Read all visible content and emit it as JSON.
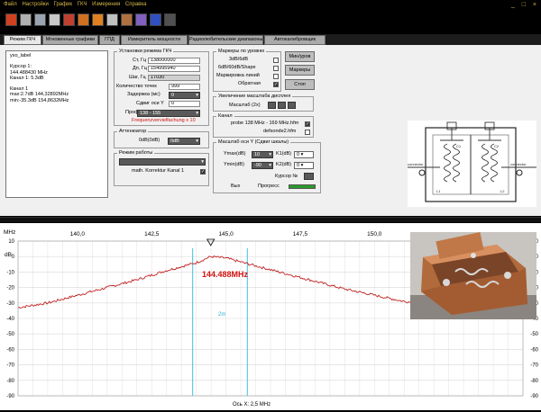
{
  "menu": {
    "items": [
      "Файл",
      "Настройки",
      "График",
      "ГКЧ",
      "Измерения",
      "Справка"
    ],
    "window_controls": "_ □ ×"
  },
  "toolbar": {
    "buttons": [
      {
        "name": "power-icon",
        "color": "#d14020"
      },
      {
        "name": "save-icon",
        "color": "#b0b0b0"
      },
      {
        "name": "print-icon",
        "color": "#9aa4b0"
      },
      {
        "name": "open-icon",
        "color": "#c8c8c8"
      },
      {
        "name": "measure-icon",
        "color": "#c04030"
      },
      {
        "name": "grid-icon",
        "color": "#d07020"
      },
      {
        "name": "chart-icon",
        "color": "#e08020"
      },
      {
        "name": "tool-icon",
        "color": "#c0c0c0"
      },
      {
        "name": "settings-icon",
        "color": "#b07040"
      },
      {
        "name": "calc-icon",
        "color": "#8060c0"
      },
      {
        "name": "window-icon",
        "color": "#3050c0"
      },
      {
        "name": "stop-icon",
        "color": "#505050"
      }
    ]
  },
  "tabs": [
    "Режим ГКЧ",
    "Мгновенные графики",
    "ГПД",
    "Измеритель мощности",
    "Радиолюбительские диапазоны",
    "Автокалибровщик"
  ],
  "info": {
    "title": "yxo_label",
    "cursor_label": "Курсор 1:",
    "cursor_freq": "144.488430 MHz",
    "cursor_level": "Канал 1:  5.3dB",
    "chan_label": "Канал 1",
    "max": "max:2.7dB 144,32892MHz",
    "min": "min:-35.3dB 154,8632MHz"
  },
  "gkch": {
    "legend": "Установки режима ГКЧ",
    "start_label": "Ст, Гц",
    "start_value": "138000000",
    "stop_label": "Дп, Гц",
    "stop_value": "154995940",
    "step_label": "Шаг, Гц",
    "step_value": "17030",
    "points_label": "Количество точек",
    "points_value": "999",
    "delay_label": "Задержка (мс)",
    "delay_value": "0",
    "yshift_label": "Сдвиг оси Y",
    "yshift_value": "0",
    "profile_label": "Проф",
    "profile_value": "138 - 155",
    "warning": "Frequenzvervielfachung x 10"
  },
  "attenuator": {
    "legend": "Аттенюатор",
    "db_label": "0dB(0dB)",
    "db_value": "0dB"
  },
  "mode": {
    "legend": "Режим работы",
    "select_value": "",
    "correction_label": "math. Korrektur Kanal 1"
  },
  "markers": {
    "legend": "Маркеры по уровню",
    "items": [
      "3dB/6dB",
      "6dB/60dB/Shape",
      "Маркировка линий",
      "Обратная"
    ],
    "checked": [
      false,
      false,
      false,
      true
    ],
    "btn_levels": "Мин/уров",
    "btn_markers": "Маркеры",
    "btn_stop": "Стоп"
  },
  "zoom": {
    "legend": "Увеличение масштаба дисплея",
    "label": "Масштаб (2x)"
  },
  "channel": {
    "legend": "Канал",
    "probe1": "probe 138 MHz - 169 MHz.hfm",
    "probe2": "defsonde2.hfm",
    "checked": [
      true,
      false
    ]
  },
  "scale": {
    "legend": "Масштаб оси Y (Сдвиг шкалы)",
    "ymax_label": "Ymax(dB)",
    "ymax_value": "10",
    "ymin_label": "Ymin(dB)",
    "ymin_value": "-90",
    "k1_label": "K1(dB)",
    "k1_value": "0",
    "k2_label": "K2(dB)",
    "k2_value": "0",
    "cursor_label": "Курсор №",
    "vbx_label": "Вых",
    "progress_label": "Прогресс",
    "progress": 1.0
  },
  "plot": {
    "unit_top": "MHz",
    "x_ticks": [
      "140,0",
      "142,5",
      "145,0",
      "147,5",
      "150,0"
    ],
    "y_unit": "dB",
    "y_ticks_left": [
      "10",
      "0",
      "-10",
      "-20",
      "-30",
      "-40",
      "-50",
      "-60",
      "-70",
      "-80",
      "-90"
    ],
    "y_ticks_right": [
      "10",
      "0",
      "-10",
      "-20",
      "-30",
      "-40",
      "-50",
      "-60",
      "-70",
      "-80",
      "-90"
    ],
    "peak_label": "144.488MHz",
    "bw_label": "2m",
    "x_axis_label": "Ось X: 2,5 MHz",
    "trace_color": "#c02020",
    "grid_color": "#d8d8d8",
    "marker_color": "#40c0e0"
  },
  "chart_data": {
    "type": "line",
    "title": "",
    "xlabel": "Ось X: 2,5 MHz",
    "ylabel": "dB",
    "xlim": [
      138.0,
      155.0
    ],
    "ylim": [
      -90,
      10
    ],
    "x": [
      138.0,
      139.0,
      140.0,
      141.0,
      142.0,
      143.0,
      144.0,
      144.49,
      145.0,
      146.0,
      147.0,
      148.0,
      149.0,
      150.0,
      151.0,
      152.0,
      153.0,
      154.0,
      155.0
    ],
    "y": [
      -33,
      -30,
      -25,
      -20,
      -15,
      -9,
      -4,
      0,
      -1,
      -6,
      -11,
      -16,
      -21,
      -25,
      -29,
      -31,
      -33,
      -34,
      -35
    ],
    "markers_x": [
      143.88,
      145.72
    ],
    "peak_x": 144.488
  }
}
